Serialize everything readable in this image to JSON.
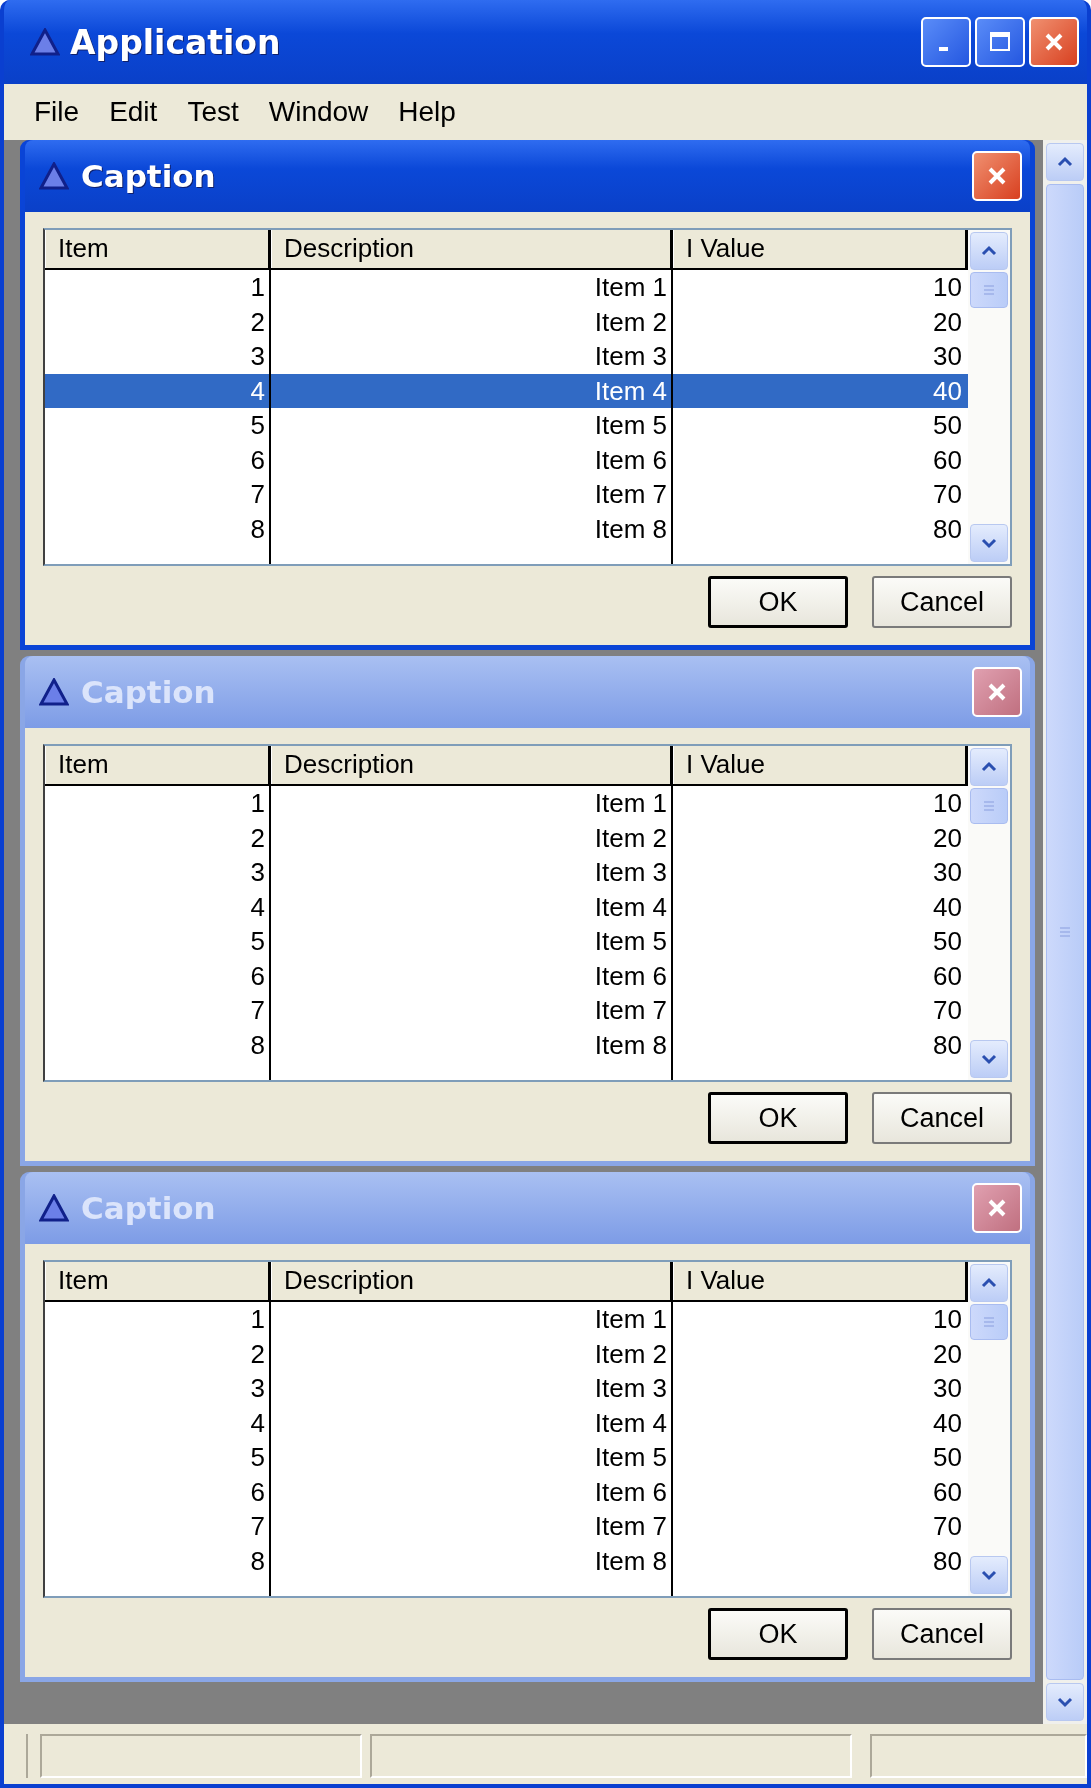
{
  "window": {
    "title": "Application"
  },
  "menu": [
    "File",
    "Edit",
    "Test",
    "Window",
    "Help"
  ],
  "dialogs": [
    {
      "title": "Caption",
      "active": true,
      "columns": [
        "Item",
        "Description",
        "I Value"
      ],
      "rows": [
        {
          "item": "1",
          "description": "Item 1",
          "value": "10",
          "selected": false
        },
        {
          "item": "2",
          "description": "Item 2",
          "value": "20",
          "selected": false
        },
        {
          "item": "3",
          "description": "Item 3",
          "value": "30",
          "selected": false
        },
        {
          "item": "4",
          "description": "Item 4",
          "value": "40",
          "selected": true
        },
        {
          "item": "5",
          "description": "Item 5",
          "value": "50",
          "selected": false
        },
        {
          "item": "6",
          "description": "Item 6",
          "value": "60",
          "selected": false
        },
        {
          "item": "7",
          "description": "Item 7",
          "value": "70",
          "selected": false
        },
        {
          "item": "8",
          "description": "Item 8",
          "value": "80",
          "selected": false
        }
      ],
      "buttons": [
        "OK",
        "Cancel"
      ]
    },
    {
      "title": "Caption",
      "active": false,
      "columns": [
        "Item",
        "Description",
        "I Value"
      ],
      "rows": [
        {
          "item": "1",
          "description": "Item 1",
          "value": "10",
          "selected": false
        },
        {
          "item": "2",
          "description": "Item 2",
          "value": "20",
          "selected": false
        },
        {
          "item": "3",
          "description": "Item 3",
          "value": "30",
          "selected": false
        },
        {
          "item": "4",
          "description": "Item 4",
          "value": "40",
          "selected": false
        },
        {
          "item": "5",
          "description": "Item 5",
          "value": "50",
          "selected": false
        },
        {
          "item": "6",
          "description": "Item 6",
          "value": "60",
          "selected": false
        },
        {
          "item": "7",
          "description": "Item 7",
          "value": "70",
          "selected": false
        },
        {
          "item": "8",
          "description": "Item 8",
          "value": "80",
          "selected": false
        }
      ],
      "buttons": [
        "OK",
        "Cancel"
      ]
    },
    {
      "title": "Caption",
      "active": false,
      "columns": [
        "Item",
        "Description",
        "I Value"
      ],
      "rows": [
        {
          "item": "1",
          "description": "Item 1",
          "value": "10",
          "selected": false
        },
        {
          "item": "2",
          "description": "Item 2",
          "value": "20",
          "selected": false
        },
        {
          "item": "3",
          "description": "Item 3",
          "value": "30",
          "selected": false
        },
        {
          "item": "4",
          "description": "Item 4",
          "value": "40",
          "selected": false
        },
        {
          "item": "5",
          "description": "Item 5",
          "value": "50",
          "selected": false
        },
        {
          "item": "6",
          "description": "Item 6",
          "value": "60",
          "selected": false
        },
        {
          "item": "7",
          "description": "Item 7",
          "value": "70",
          "selected": false
        },
        {
          "item": "8",
          "description": "Item 8",
          "value": "80",
          "selected": false
        }
      ],
      "buttons": [
        "OK",
        "Cancel"
      ]
    }
  ]
}
